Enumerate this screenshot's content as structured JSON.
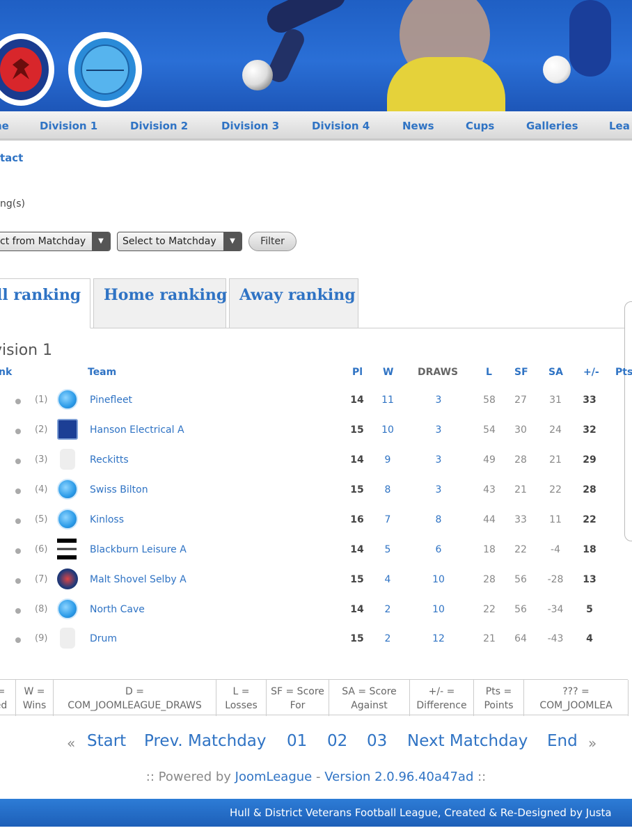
{
  "nav": {
    "items": [
      "ne",
      "Division 1",
      "Division 2",
      "Division 3",
      "Division 4",
      "News",
      "Cups",
      "Galleries",
      "Lea"
    ]
  },
  "contact_label": "tact",
  "rankings_label": "ng(s)",
  "filters": {
    "from_value": "ct from Matchday",
    "to_value": "Select to Matchday",
    "filter_label": "Filter"
  },
  "tabs": {
    "overall": "ll ranking",
    "home": "Home ranking",
    "away": "Away ranking"
  },
  "division_title": "vision 1",
  "table": {
    "headers": {
      "rank": "nk",
      "team": "Team",
      "pl": "Pl",
      "w": "W",
      "draws": "DRAWS",
      "l": "L",
      "sf": "SF",
      "sa": "SA",
      "gd": "+/-",
      "pts": "Pts"
    },
    "rows": [
      {
        "prev": "(1)",
        "team": "Pinefleet",
        "pl": "14",
        "w": "11",
        "d": "3",
        "l": "58",
        "sf": "27",
        "sa": "31",
        "gd": "33",
        "crest": "blue"
      },
      {
        "prev": "(2)",
        "team": "Hanson Electrical A",
        "pl": "15",
        "w": "10",
        "d": "3",
        "l": "54",
        "sf": "30",
        "sa": "24",
        "gd": "32",
        "crest": "navy"
      },
      {
        "prev": "(3)",
        "team": "Reckitts",
        "pl": "14",
        "w": "9",
        "d": "3",
        "l": "49",
        "sf": "28",
        "sa": "21",
        "gd": "29",
        "crest": "grey"
      },
      {
        "prev": "(4)",
        "team": "Swiss Bilton",
        "pl": "15",
        "w": "8",
        "d": "3",
        "l": "43",
        "sf": "21",
        "sa": "22",
        "gd": "28",
        "crest": "blue"
      },
      {
        "prev": "(5)",
        "team": "Kinloss",
        "pl": "16",
        "w": "7",
        "d": "8",
        "l": "44",
        "sf": "33",
        "sa": "11",
        "gd": "22",
        "crest": "blue"
      },
      {
        "prev": "(6)",
        "team": "Blackburn Leisure A",
        "pl": "14",
        "w": "5",
        "d": "6",
        "l": "18",
        "sf": "22",
        "sa": "-4",
        "gd": "18",
        "crest": "flag"
      },
      {
        "prev": "(7)",
        "team": "Malt Shovel Selby A",
        "pl": "15",
        "w": "4",
        "d": "10",
        "l": "28",
        "sf": "56",
        "sa": "-28",
        "gd": "13",
        "crest": "red"
      },
      {
        "prev": "(8)",
        "team": "North Cave",
        "pl": "14",
        "w": "2",
        "d": "10",
        "l": "22",
        "sf": "56",
        "sa": "-34",
        "gd": "5",
        "crest": "blue"
      },
      {
        "prev": "(9)",
        "team": "Drum",
        "pl": "15",
        "w": "2",
        "d": "12",
        "l": "21",
        "sf": "64",
        "sa": "-43",
        "gd": "4",
        "crest": "grey"
      }
    ]
  },
  "legend": [
    {
      "top": "=",
      "bottom": "ed"
    },
    {
      "top": "W =",
      "bottom": "Wins"
    },
    {
      "top": "D =",
      "bottom": "COM_JOOMLEAGUE_DRAWS"
    },
    {
      "top": "L =",
      "bottom": "Losses"
    },
    {
      "top": "SF = Score",
      "bottom": "For"
    },
    {
      "top": "SA = Score",
      "bottom": "Against"
    },
    {
      "top": "+/- =",
      "bottom": "Difference"
    },
    {
      "top": "Pts =",
      "bottom": "Points"
    },
    {
      "top": "??? =",
      "bottom": "COM_JOOMLEA"
    }
  ],
  "pager": {
    "left_arrow": "«",
    "start": "Start",
    "prev": "Prev. Matchday",
    "p1": "01",
    "p2": "02",
    "p3": "03",
    "next": "Next Matchday",
    "end": "End",
    "right_arrow": "»"
  },
  "powered": {
    "prefix": ":: Powered by ",
    "link": "JoomLeague",
    "sep": " - ",
    "version": "Version 2.0.96.40a47ad",
    "suffix": " ::"
  },
  "footer": "Hull & District Veterans Football League, Created & Re-Designed by Justa"
}
